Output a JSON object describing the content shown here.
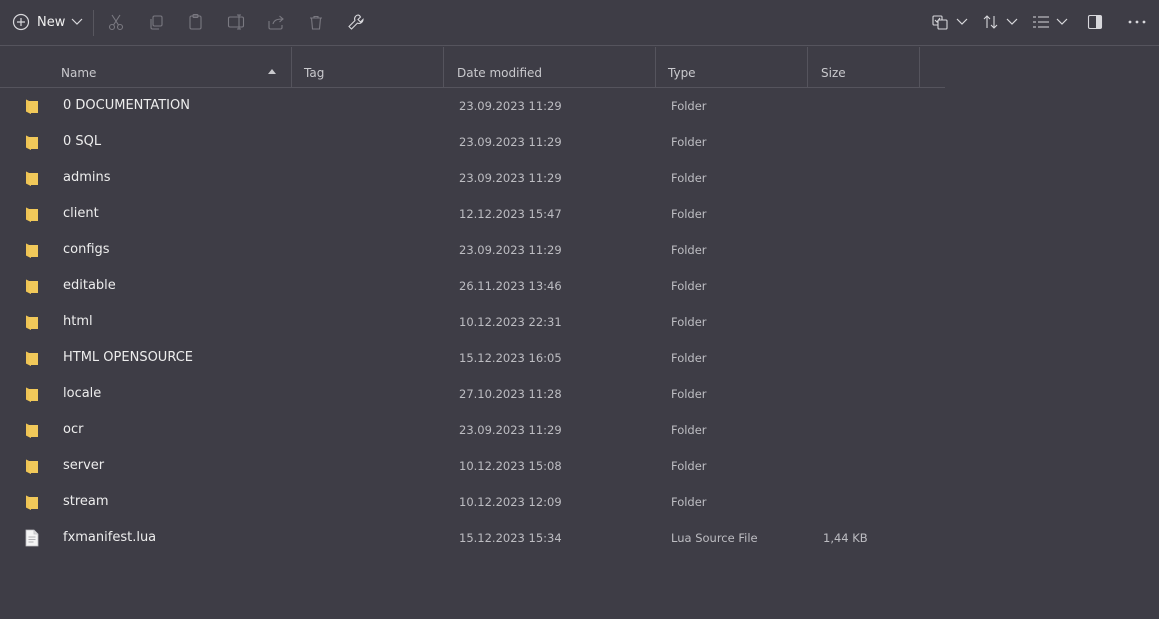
{
  "toolbar": {
    "new_label": "New",
    "icons": [
      "plus-circle-icon",
      "cut-icon",
      "copy-icon",
      "paste-icon",
      "rename-icon",
      "share-icon",
      "delete-icon",
      "wrench-icon",
      "view-options-icon",
      "sort-icon",
      "layout-icon",
      "details-pane-icon",
      "more-icon"
    ]
  },
  "columns": {
    "name": "Name",
    "tag": "Tag",
    "date": "Date modified",
    "type": "Type",
    "size": "Size",
    "sort": "ascending"
  },
  "files": [
    {
      "name": "0 DOCUMENTATION",
      "date": "23.09.2023 11:29",
      "type": "Folder",
      "size": "",
      "kind": "folder"
    },
    {
      "name": "0 SQL",
      "date": "23.09.2023 11:29",
      "type": "Folder",
      "size": "",
      "kind": "folder"
    },
    {
      "name": "admins",
      "date": "23.09.2023 11:29",
      "type": "Folder",
      "size": "",
      "kind": "folder"
    },
    {
      "name": "client",
      "date": "12.12.2023 15:47",
      "type": "Folder",
      "size": "",
      "kind": "folder"
    },
    {
      "name": "configs",
      "date": "23.09.2023 11:29",
      "type": "Folder",
      "size": "",
      "kind": "folder"
    },
    {
      "name": "editable",
      "date": "26.11.2023 13:46",
      "type": "Folder",
      "size": "",
      "kind": "folder"
    },
    {
      "name": "html",
      "date": "10.12.2023 22:31",
      "type": "Folder",
      "size": "",
      "kind": "folder"
    },
    {
      "name": "HTML OPENSOURCE",
      "date": "15.12.2023 16:05",
      "type": "Folder",
      "size": "",
      "kind": "folder"
    },
    {
      "name": "locale",
      "date": "27.10.2023 11:28",
      "type": "Folder",
      "size": "",
      "kind": "folder"
    },
    {
      "name": "ocr",
      "date": "23.09.2023 11:29",
      "type": "Folder",
      "size": "",
      "kind": "folder"
    },
    {
      "name": "server",
      "date": "10.12.2023 15:08",
      "type": "Folder",
      "size": "",
      "kind": "folder"
    },
    {
      "name": "stream",
      "date": "10.12.2023 12:09",
      "type": "Folder",
      "size": "",
      "kind": "folder"
    },
    {
      "name": "fxmanifest.lua",
      "date": "15.12.2023 15:34",
      "type": "Lua Source File",
      "size": "1,44 KB",
      "kind": "file"
    }
  ],
  "colors": {
    "background": "#3e3d46",
    "folder": "#f1c95a",
    "folder_dark": "#d9a93a"
  }
}
